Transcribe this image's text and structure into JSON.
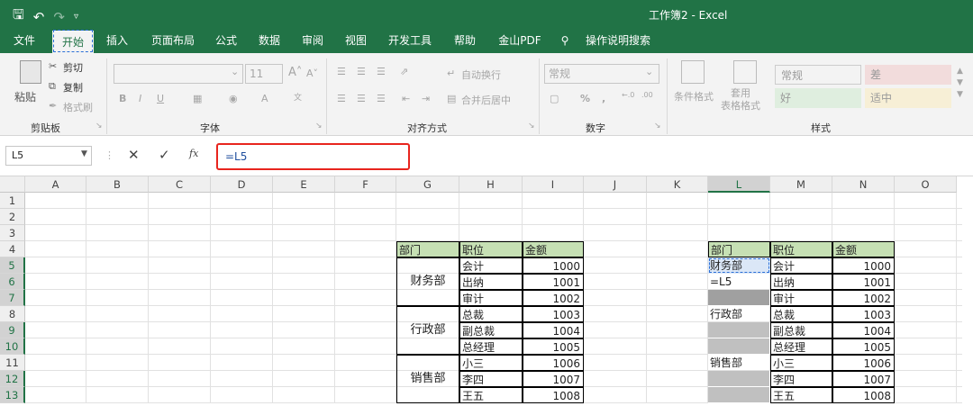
{
  "window": {
    "title": "工作簿2  -  Excel"
  },
  "tabs": [
    "文件",
    "开始",
    "插入",
    "页面布局",
    "公式",
    "数据",
    "审阅",
    "视图",
    "开发工具",
    "帮助",
    "金山PDF",
    "操作说明搜索"
  ],
  "ribbon": {
    "clipboard": {
      "paste": "粘贴",
      "cut": "剪切",
      "copy": "复制",
      "format_painter": "格式刷",
      "group": "剪贴板"
    },
    "font": {
      "size": "11",
      "bold": "B",
      "italic": "I",
      "underline": "U",
      "group": "字体"
    },
    "alignment": {
      "wrap": "自动换行",
      "merge": "合并后居中",
      "group": "对齐方式"
    },
    "number": {
      "format": "常规",
      "percent": "%",
      "comma": ",",
      "group": "数字"
    },
    "styles": {
      "cond_format": "条件格式",
      "table_format": "套用\n表格格式",
      "normal": "常规",
      "bad": "差",
      "good": "好",
      "neutral": "适中",
      "group": "样式"
    }
  },
  "formula": {
    "namebox": "L5",
    "content": "=L5",
    "cancel": "✕",
    "enter": "✓",
    "fx": "fx"
  },
  "columns": [
    "A",
    "B",
    "C",
    "D",
    "E",
    "F",
    "G",
    "H",
    "I",
    "J",
    "K",
    "L",
    "M",
    "N",
    "O"
  ],
  "rows": [
    "1",
    "2",
    "3",
    "4",
    "5",
    "6",
    "7",
    "8",
    "9",
    "10",
    "11",
    "12",
    "13"
  ],
  "selected": {
    "column": "L",
    "rows": [
      "5",
      "6",
      "7",
      "9",
      "10",
      "12",
      "13"
    ]
  },
  "table_left": {
    "headers": [
      "部门",
      "职位",
      "金额"
    ],
    "groups": [
      {
        "dept": "财务部",
        "items": [
          [
            "会计",
            "1000"
          ],
          [
            "出纳",
            "1001"
          ],
          [
            "审计",
            "1002"
          ]
        ]
      },
      {
        "dept": "行政部",
        "items": [
          [
            "总裁",
            "1003"
          ],
          [
            "副总裁",
            "1004"
          ],
          [
            "总经理",
            "1005"
          ]
        ]
      },
      {
        "dept": "销售部",
        "items": [
          [
            "小三",
            "1006"
          ],
          [
            "李四",
            "1007"
          ],
          [
            "王五",
            "1008"
          ]
        ]
      }
    ]
  },
  "table_right": {
    "headers": [
      "部门",
      "职位",
      "金额"
    ],
    "dept_cells": [
      "财务部",
      "=L5",
      "",
      "行政部",
      "",
      "",
      "销售部",
      "",
      ""
    ],
    "positions": [
      "会计",
      "出纳",
      "审计",
      "总裁",
      "副总裁",
      "总经理",
      "小三",
      "李四",
      "王五"
    ],
    "amounts": [
      "1000",
      "1001",
      "1002",
      "1003",
      "1004",
      "1005",
      "1006",
      "1007",
      "1008"
    ]
  }
}
